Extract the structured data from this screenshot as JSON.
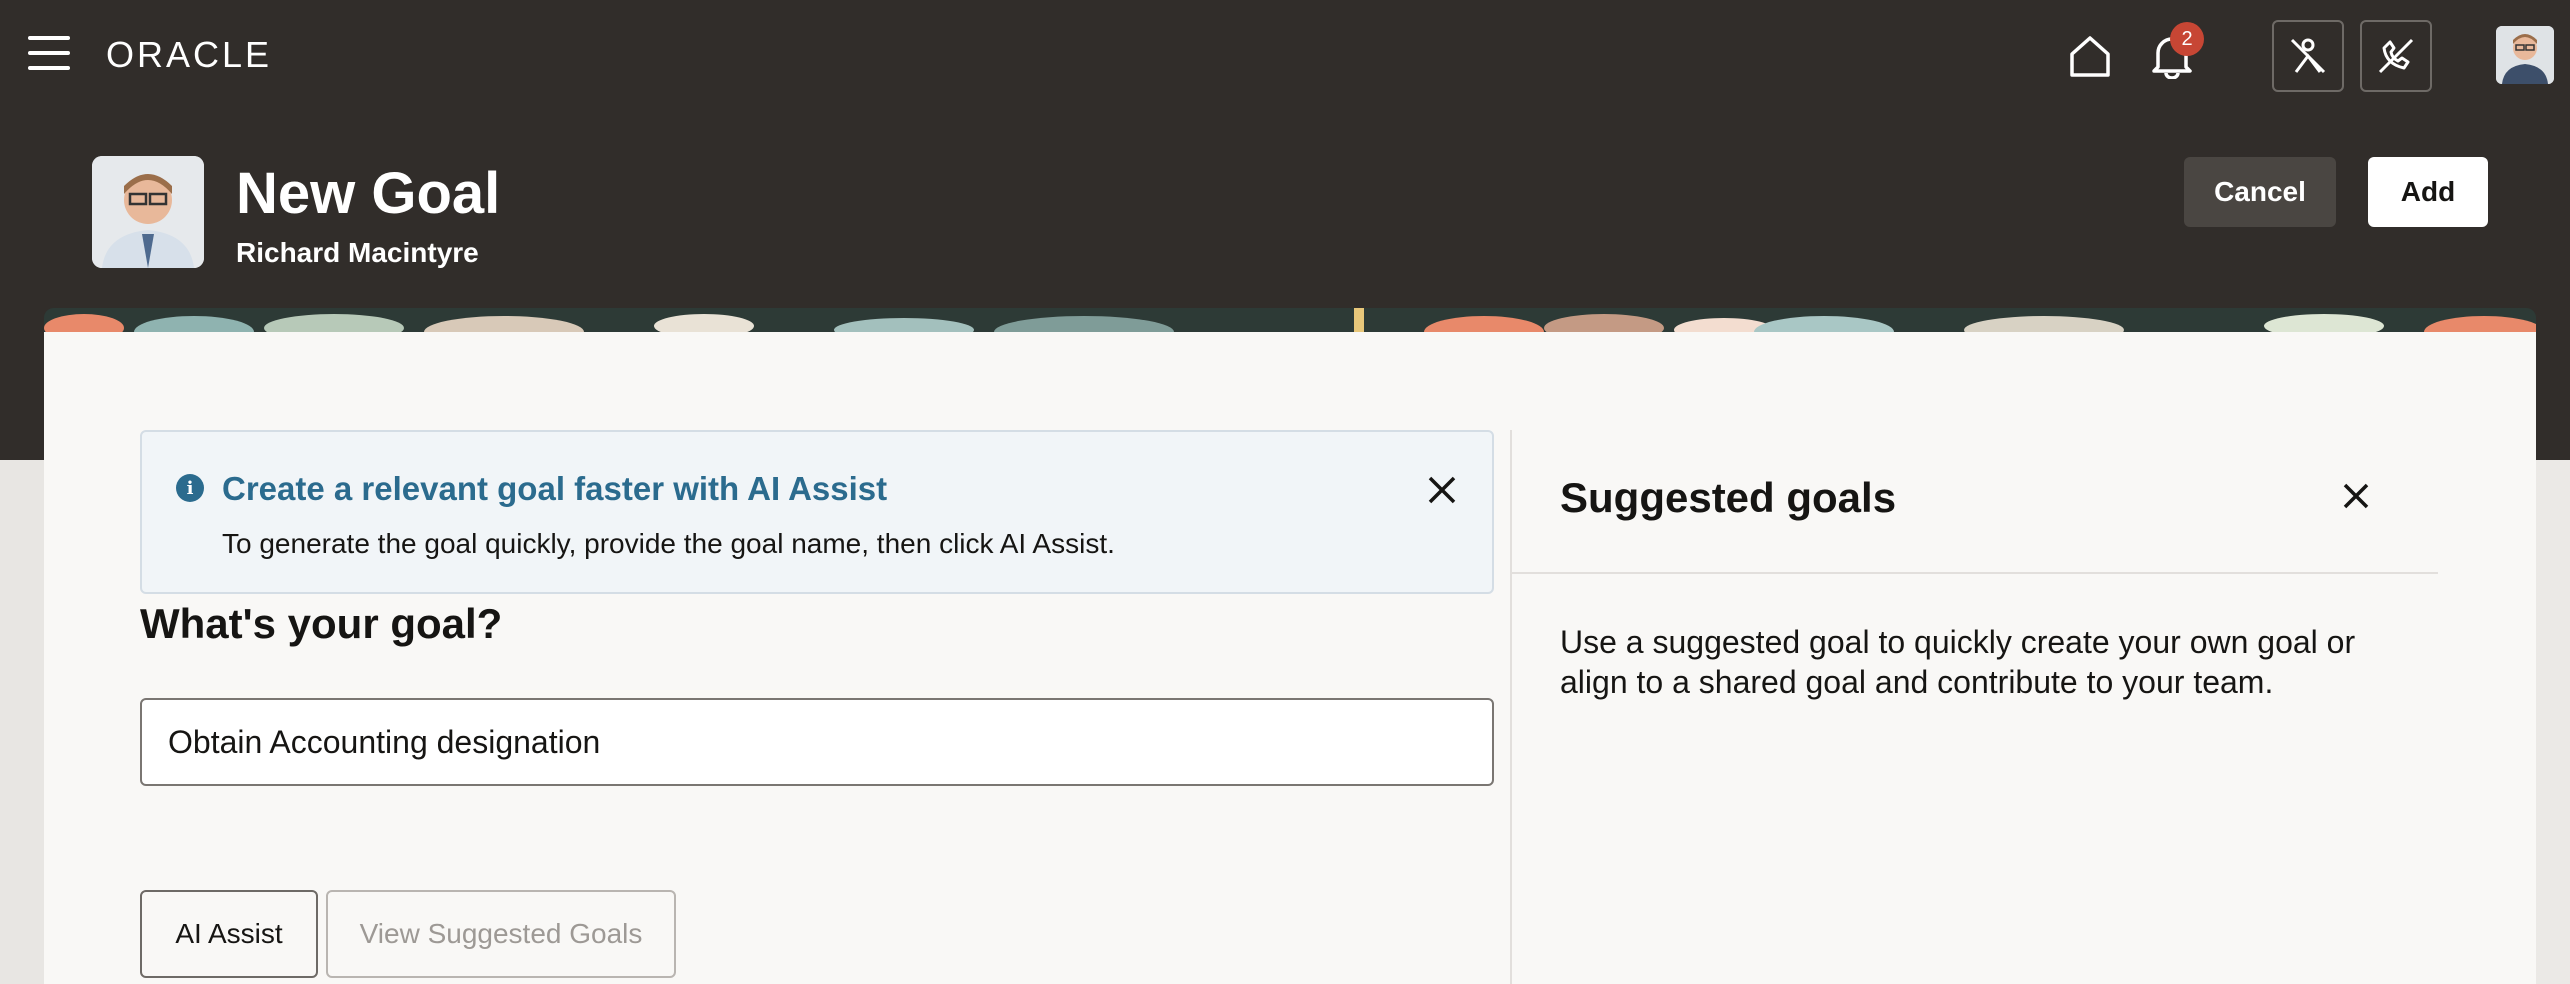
{
  "header": {
    "brand": "ORACLE",
    "notification_count": "2",
    "menu_icon": "hamburger-menu-icon",
    "home_icon": "home-icon",
    "bell_icon": "bell-icon"
  },
  "page": {
    "title": "New Goal",
    "subtitle": "Richard Macintyre"
  },
  "actions": {
    "cancel_label": "Cancel",
    "add_label": "Add"
  },
  "info_banner": {
    "title": "Create a relevant goal faster with AI Assist",
    "text": "To generate the goal quickly, provide the goal name, then click AI Assist."
  },
  "form": {
    "goal_label": "What's your goal?",
    "goal_value": "Obtain Accounting designation"
  },
  "buttons": {
    "ai_assist": "AI Assist",
    "view_suggested": "View Suggested Goals"
  },
  "suggested_panel": {
    "title": "Suggested goals",
    "text": "Use a suggested goal to quickly create your own goal or align to a shared goal and contribute to your team."
  },
  "colors": {
    "header_bg": "#312d2a",
    "accent_blue": "#2b6b8e",
    "badge_red": "#c74634",
    "content_bg": "#f9f8f6"
  }
}
